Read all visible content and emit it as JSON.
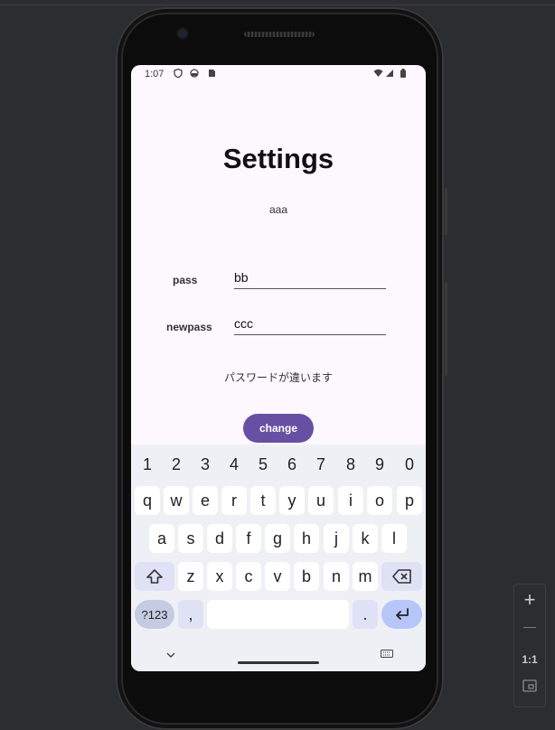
{
  "status_bar": {
    "time": "1:07"
  },
  "screen": {
    "title": "Settings",
    "subtitle": "aaa",
    "pass_label": "pass",
    "pass_value": "bb",
    "newpass_label": "newpass",
    "newpass_value": "ccc",
    "error_message": "パスワードが違います",
    "change_button": "change"
  },
  "keyboard": {
    "numbers": [
      "1",
      "2",
      "3",
      "4",
      "5",
      "6",
      "7",
      "8",
      "9",
      "0"
    ],
    "row1": [
      "q",
      "w",
      "e",
      "r",
      "t",
      "y",
      "u",
      "i",
      "o",
      "p"
    ],
    "row2": [
      "a",
      "s",
      "d",
      "f",
      "g",
      "h",
      "j",
      "k",
      "l"
    ],
    "row3": [
      "z",
      "x",
      "c",
      "v",
      "b",
      "n",
      "m"
    ],
    "symbols_key": "?123",
    "comma_key": ",",
    "period_key": "."
  },
  "emulator_controls": {
    "zoom_in": "+",
    "zoom_out": "—",
    "actual_size": "1:1"
  }
}
